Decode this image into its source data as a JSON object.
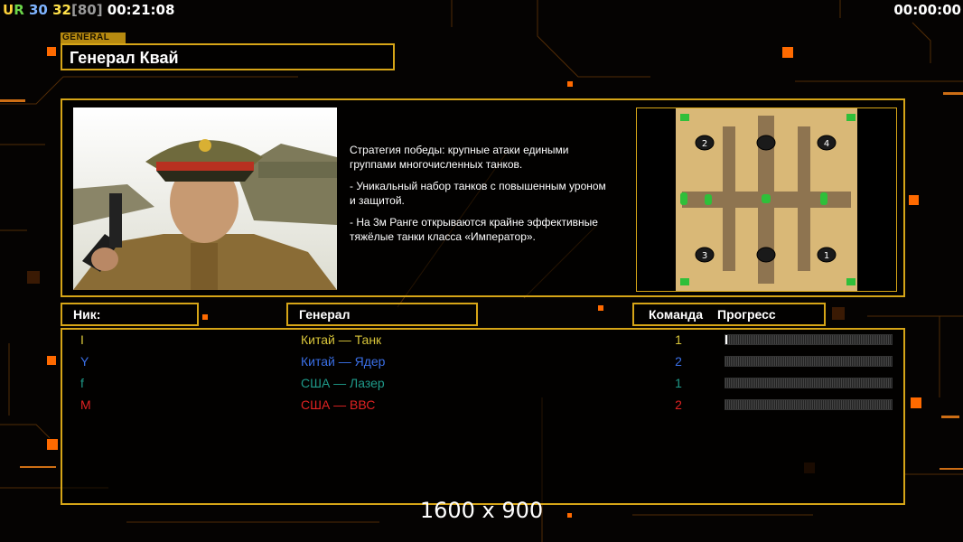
{
  "hud": {
    "ur_label": "UR",
    "n1": "30",
    "n2": "32",
    "n3": "[80]",
    "elapsed": "00:21:08",
    "timer": "00:00:00"
  },
  "general_tag": "GENERAL",
  "general_name": "Генерал Квай",
  "description": [
    "Стратегия победы: крупные атаки едиными\n группами многочисленных танков.",
    "- Уникальный набор танков с повышенным уроном\n и защитой.",
    "- На 3м Ранге открываются крайне эффективные\n тяжёлые танки класса «Император»."
  ],
  "headers": {
    "nick": "Ник:",
    "general": "Генерал",
    "team": "Команда",
    "progress": "Прогресс"
  },
  "players": [
    {
      "nick": "I",
      "general": "Китай — Танк",
      "team": "1",
      "color": "#d8c53a",
      "progress": 0.01
    },
    {
      "nick": "Y",
      "general": "Китай — Ядер",
      "team": "2",
      "color": "#3a6fe6",
      "progress": 0.0
    },
    {
      "nick": "f",
      "general": "США — Лазер",
      "team": "1",
      "color": "#1f9a8a",
      "progress": 0.0
    },
    {
      "nick": "M",
      "general": "США — ВВС",
      "team": "2",
      "color": "#e02222",
      "progress": 0.0
    }
  ],
  "map_slots": [
    "2",
    "4",
    "3",
    "1"
  ],
  "resolution": "1600 x 900",
  "colors": {
    "accent": "#d6a517",
    "orange": "#ff6a00"
  }
}
